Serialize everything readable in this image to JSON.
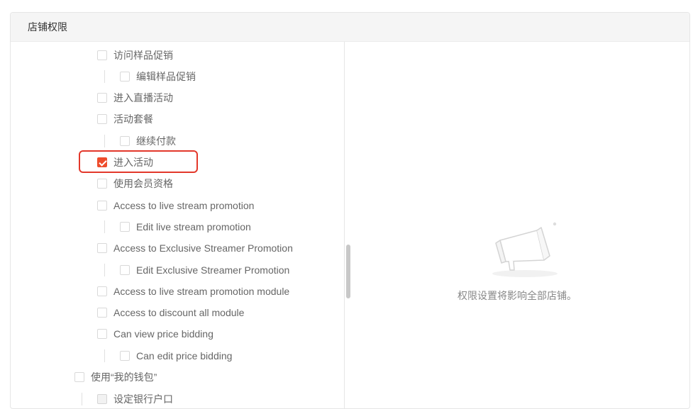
{
  "panel": {
    "title": "店铺权限"
  },
  "tree": {
    "items": [
      {
        "label": "访问样品促销",
        "checked": false
      },
      {
        "label": "编辑样品促销",
        "checked": false
      },
      {
        "label": "进入直播活动",
        "checked": false
      },
      {
        "label": "活动套餐",
        "checked": false
      },
      {
        "label": "继续付款",
        "checked": false
      },
      {
        "label": "进入活动",
        "checked": true
      },
      {
        "label": "使用会员资格",
        "checked": false
      },
      {
        "label": "Access to live stream promotion",
        "checked": false
      },
      {
        "label": "Edit live stream promotion",
        "checked": false
      },
      {
        "label": "Access to Exclusive Streamer Promotion",
        "checked": false
      },
      {
        "label": "Edit Exclusive Streamer Promotion",
        "checked": false
      },
      {
        "label": "Access to live stream promotion module",
        "checked": false
      },
      {
        "label": "Access to discount all module",
        "checked": false
      },
      {
        "label": "Can view price bidding",
        "checked": false
      },
      {
        "label": "Can edit price bidding",
        "checked": false
      },
      {
        "label": "使用“我的钱包”",
        "checked": false
      },
      {
        "label": "设定银行户口",
        "checked": false,
        "disabled": true
      }
    ]
  },
  "empty_state": {
    "icon": "megaphone-icon",
    "message": "权限设置将影响全部店铺。"
  },
  "colors": {
    "accent": "#ee4d2d",
    "highlight_border": "#e3382b"
  }
}
